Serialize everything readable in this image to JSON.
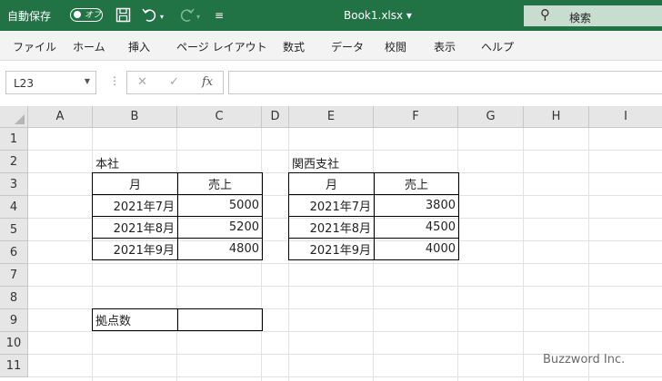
{
  "titlebar": {
    "autosave_label": "自動保存",
    "autosave_state": "オフ",
    "filename": "Book1.xlsx ▾",
    "search_label": "検索"
  },
  "ribbon": {
    "tabs": [
      "ファイル",
      "ホーム",
      "挿入",
      "ページ レイアウト",
      "数式",
      "データ",
      "校閲",
      "表示",
      "ヘルプ"
    ]
  },
  "formula_bar": {
    "name_box": "L23",
    "fx": "fx",
    "content": ""
  },
  "sheet": {
    "columns": [
      "A",
      "B",
      "C",
      "D",
      "E",
      "F",
      "G",
      "H",
      "I"
    ],
    "rows": [
      "1",
      "2",
      "3",
      "4",
      "5",
      "6",
      "7",
      "8",
      "9",
      "10",
      "11"
    ]
  },
  "honsha": {
    "title": "本社",
    "headers": [
      "月",
      "売上"
    ],
    "rows": [
      [
        "2021年7月",
        "5000"
      ],
      [
        "2021年8月",
        "5200"
      ],
      [
        "2021年9月",
        "4800"
      ]
    ]
  },
  "kansai": {
    "title": "関西支社",
    "headers": [
      "月",
      "売上"
    ],
    "rows": [
      [
        "2021年7月",
        "3800"
      ],
      [
        "2021年8月",
        "4500"
      ],
      [
        "2021年9月",
        "4000"
      ]
    ]
  },
  "kyoten": {
    "label": "拠点数",
    "value": ""
  },
  "watermark": "Buzzword Inc."
}
